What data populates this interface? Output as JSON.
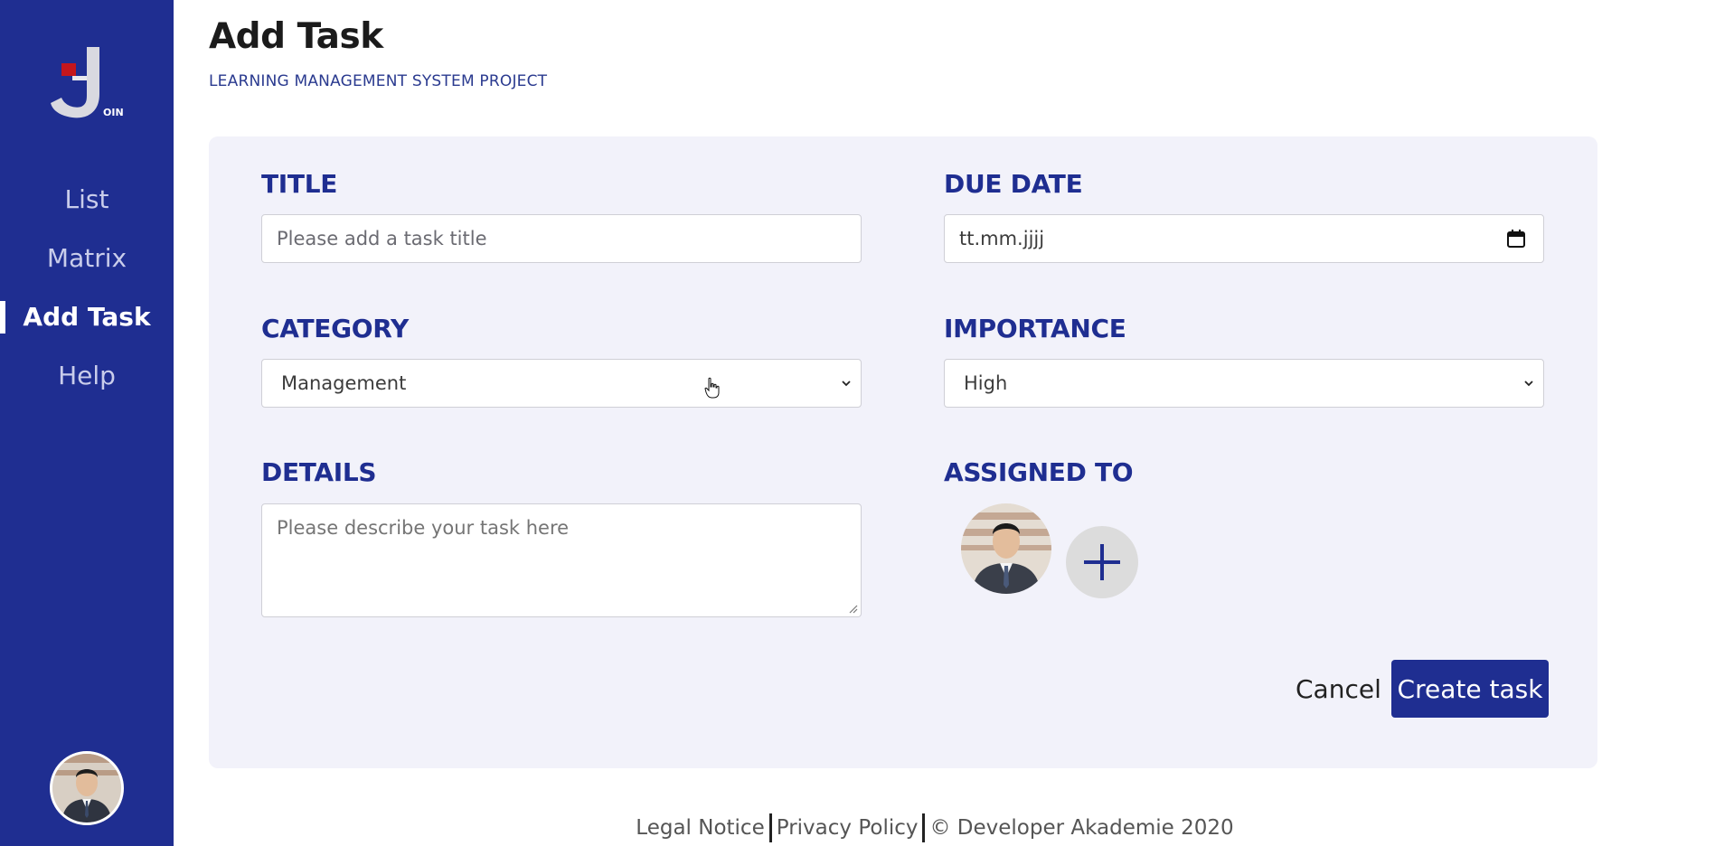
{
  "sidebar": {
    "logo_text": "OIN",
    "items": [
      {
        "label": "List",
        "active": false
      },
      {
        "label": "Matrix",
        "active": false
      },
      {
        "label": "Add Task",
        "active": true
      },
      {
        "label": "Help",
        "active": false
      }
    ]
  },
  "header": {
    "title": "Add Task",
    "subtitle": "LEARNING MANAGEMENT SYSTEM PROJECT"
  },
  "form": {
    "title_label": "TITLE",
    "title_placeholder": "Please add a task title",
    "due_date_label": "DUE DATE",
    "due_date_value": "tt.mm.jjjj",
    "category_label": "CATEGORY",
    "category_value": "Management",
    "importance_label": "IMPORTANCE",
    "importance_value": "High",
    "details_label": "DETAILS",
    "details_placeholder": "Please describe your task here",
    "assigned_label": "ASSIGNED TO",
    "cancel_label": "Cancel",
    "create_label": "Create task"
  },
  "footer": {
    "legal": "Legal Notice",
    "privacy": "Privacy Policy",
    "copyright": "© Developer Akademie 2020"
  },
  "colors": {
    "primary": "#1f2e91",
    "card_bg": "#f2f2fa"
  }
}
